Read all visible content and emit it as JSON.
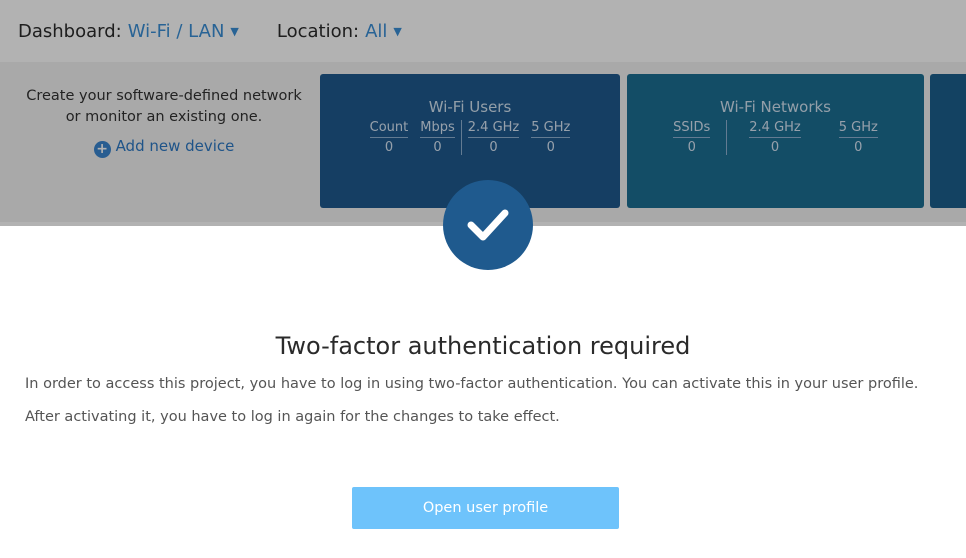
{
  "header": {
    "dashboard_label": "Dashboard:",
    "dashboard_value": "Wi-Fi / LAN",
    "location_label": "Location:",
    "location_value": "All"
  },
  "intro": {
    "text": "Create your software-defined network or monitor an existing one.",
    "add_device": "Add new device"
  },
  "cards": {
    "wifi_users": {
      "title": "Wi-Fi Users",
      "columns": [
        {
          "head": "Count",
          "value": "0"
        },
        {
          "head": "Mbps",
          "value": "0"
        },
        {
          "head": "2.4 GHz",
          "value": "0"
        },
        {
          "head": "5 GHz",
          "value": "0"
        }
      ]
    },
    "wifi_networks": {
      "title": "Wi-Fi Networks",
      "columns": [
        {
          "head": "SSIDs",
          "value": "0"
        },
        {
          "head": "2.4 GHz",
          "value": "0"
        },
        {
          "head": "5 GHz",
          "value": "0"
        }
      ]
    }
  },
  "modal": {
    "title": "Two-factor authentication required",
    "paragraph1": "In order to access this project, you have to log in using two-factor authentication. You can activate this in your user profile.",
    "paragraph2": "After activating it, you have to log in again for the changes to take effect.",
    "button_label": "Open user profile"
  },
  "icons": {
    "status": "checkmark-icon",
    "add": "plus-circle-icon",
    "dropdown": "caret-down-icon"
  },
  "colors": {
    "accent": "#3a8fd6",
    "card_users": "#1f5a8e",
    "card_networks": "#1c6f93",
    "button": "#6ec3fb"
  }
}
